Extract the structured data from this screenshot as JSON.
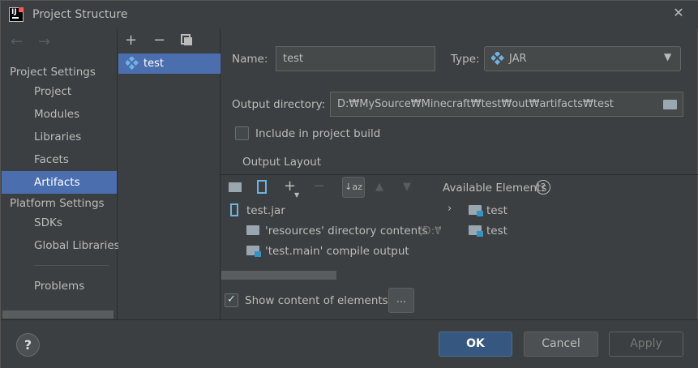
{
  "window": {
    "title": "Project Structure"
  },
  "nav": {
    "back_icon": "arrow-left-icon",
    "forward_icon": "arrow-right-icon"
  },
  "sidebar": {
    "section1": "Project Settings",
    "items1": [
      {
        "label": "Project"
      },
      {
        "label": "Modules"
      },
      {
        "label": "Libraries"
      },
      {
        "label": "Facets"
      },
      {
        "label": "Artifacts"
      }
    ],
    "section2": "Platform Settings",
    "items2": [
      {
        "label": "SDKs"
      },
      {
        "label": "Global Libraries"
      }
    ],
    "problems": "Problems",
    "selected": "Artifacts"
  },
  "artifacts_list": {
    "add": "+",
    "remove": "−",
    "items": [
      {
        "label": "test"
      }
    ]
  },
  "form": {
    "name_label": "Name:",
    "name_value": "test",
    "type_label": "Type:",
    "type_value": "JAR",
    "output_dir_label": "Output directory:",
    "output_dir_value": "D:₩MySource₩Minecraft₩test₩out₩artifacts₩test",
    "include_label": "Include in project build",
    "include_checked": false,
    "output_layout_tab": "Output Layout"
  },
  "layout_tree": {
    "items": [
      {
        "label": "test.jar"
      },
      {
        "label": "'resources' directory contents",
        "suffix": "(D:₩"
      },
      {
        "label": "'test.main' compile output"
      }
    ]
  },
  "available": {
    "title": "Available Elements",
    "items": [
      {
        "label": "test"
      },
      {
        "label": "test"
      }
    ]
  },
  "show_content": {
    "label": "Show content of elements",
    "checked": true,
    "more": "..."
  },
  "footer": {
    "help": "?",
    "ok": "OK",
    "cancel": "Cancel",
    "apply": "Apply"
  },
  "colors": {
    "selection": "#4b6eaf",
    "background": "#3c3f41",
    "primary_button": "#365880",
    "tree_icon": "#3592c4"
  }
}
